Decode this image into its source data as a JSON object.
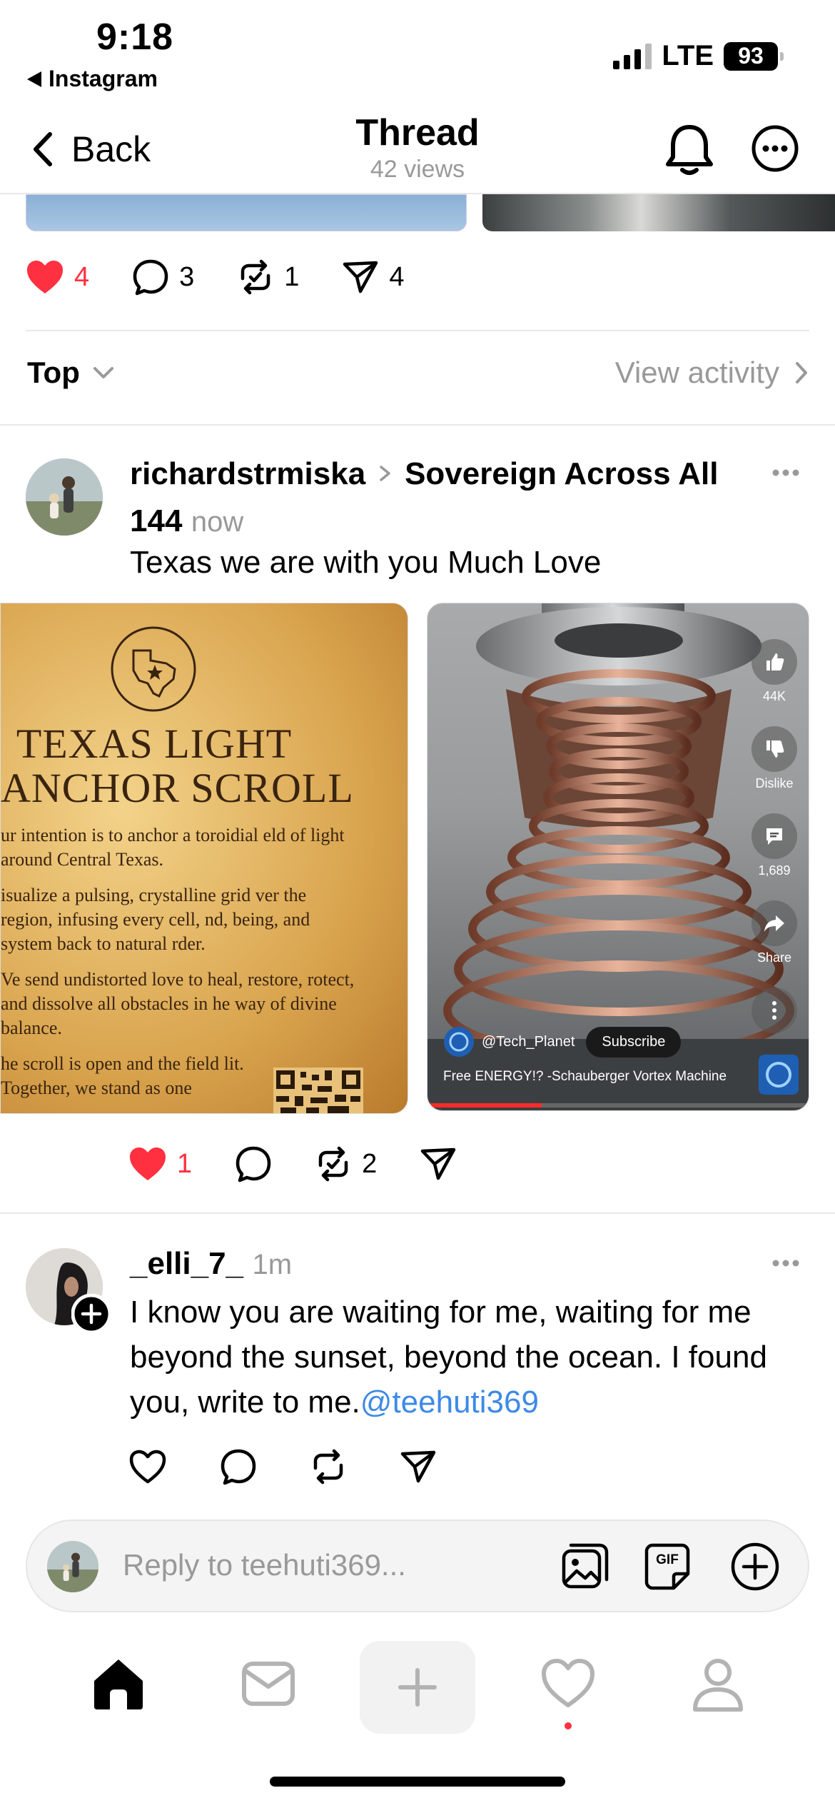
{
  "status": {
    "time": "9:18",
    "back_app": "Instagram",
    "network": "LTE",
    "battery": "93"
  },
  "nav": {
    "back_label": "Back",
    "title": "Thread",
    "views": "42 views"
  },
  "top_post": {
    "likes": "4",
    "comments": "3",
    "reposts": "1",
    "shares": "4"
  },
  "sort": {
    "label": "Top",
    "view_activity": "View activity"
  },
  "reply1": {
    "username": "richardstrmiska",
    "community": "Sovereign Across All 144",
    "time": "now",
    "text": "Texas we are with you Much Love",
    "scroll": {
      "title1": "TEXAS LIGHT",
      "title2": "ANCHOR SCROLL",
      "p1": "ur intention is to anchor a toroidial eld of light around Central Texas.",
      "p2": "isualize a pulsing, crystalline grid ver the region, infusing every cell, nd, being, and system back to natural rder.",
      "p3": "Ve send undistorted love to heal, restore, rotect, and dissolve all obstacles in he way of divine balance.",
      "p4": "he scroll is open and the field lit. Together, we stand as one"
    },
    "video": {
      "likes": "44K",
      "dislike": "Dislike",
      "comments": "1,689",
      "share": "Share",
      "channel": "@Tech_Planet",
      "subscribe": "Subscribe",
      "title": "Free ENERGY!? -Schauberger Vortex Machine"
    },
    "likes": "1",
    "reposts": "2"
  },
  "reply2": {
    "username": "_elli_7_",
    "time": "1m",
    "text": "I know you are waiting for me, waiting for me beyond the sunset, beyond the ocean. I found you, write to me.",
    "mention": "@teehuti369"
  },
  "composer": {
    "placeholder": "Reply to teehuti369...",
    "gif_label": "GIF"
  },
  "colors": {
    "like_red": "#ff3040",
    "link_blue": "#3d8ae5",
    "muted": "#999999"
  }
}
